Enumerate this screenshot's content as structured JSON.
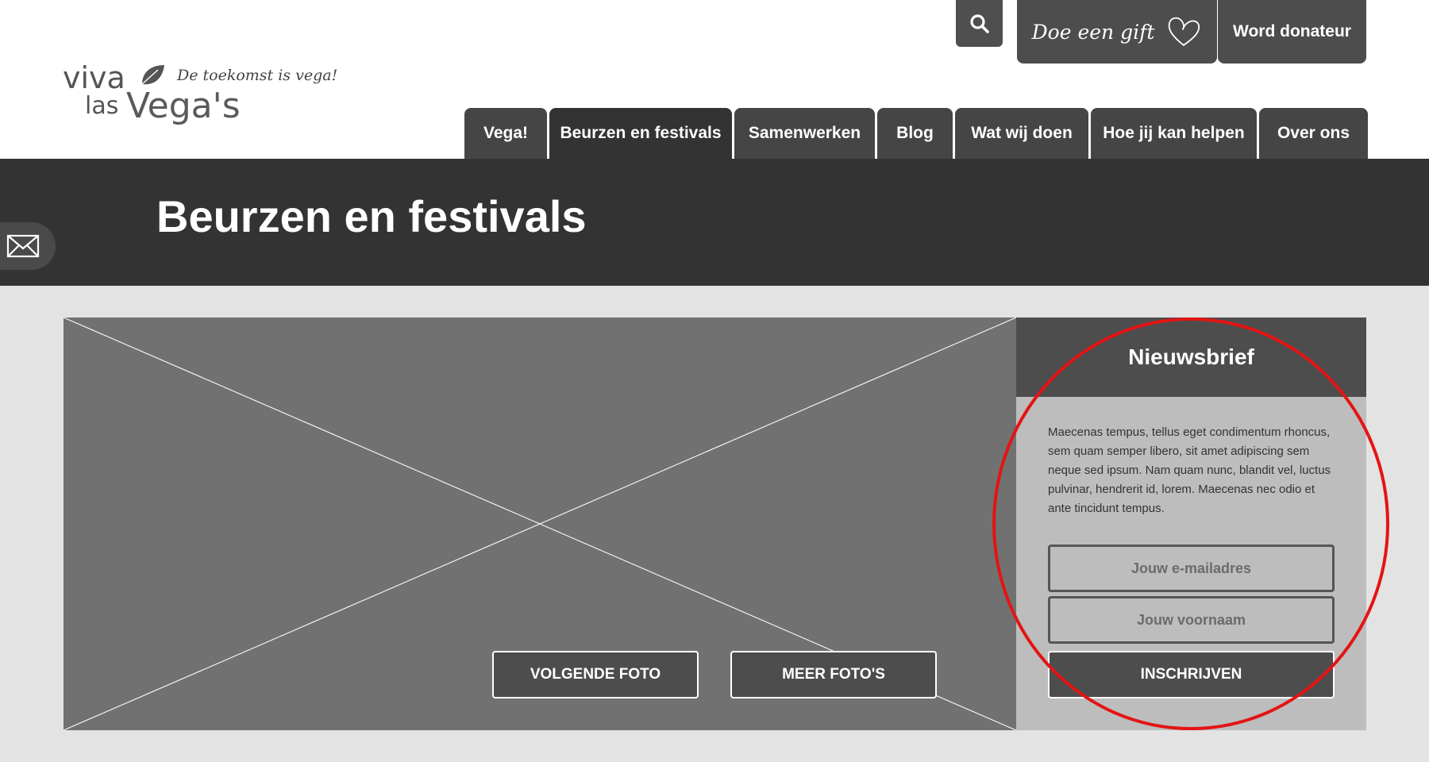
{
  "header": {
    "logo": {
      "line1": "viva",
      "line2a": "las",
      "line2b": "Vega's",
      "tagline": "De toekomst is vega!"
    },
    "search_icon": "search-icon",
    "gift_label": "Doe een gift",
    "gift_icon": "heart-icon",
    "donate_label": "Word donateur"
  },
  "nav": {
    "items": [
      {
        "label": "Vega!"
      },
      {
        "label": "Beurzen en festivals",
        "active": true
      },
      {
        "label": "Samenwerken"
      },
      {
        "label": "Blog"
      },
      {
        "label": "Wat wij doen"
      },
      {
        "label": "Hoe jij kan helpen"
      },
      {
        "label": "Over ons"
      }
    ]
  },
  "hero": {
    "title": "Beurzen en festivals",
    "mail_icon": "envelope-icon"
  },
  "photo": {
    "next_label": "VOLGENDE FOTO",
    "more_label": "MEER FOTO'S"
  },
  "newsletter": {
    "title": "Nieuwsbrief",
    "text": "Maecenas tempus, tellus eget condimentum rhoncus, sem quam semper libero, sit amet adipiscing sem neque sed ipsum. Nam quam nunc, blandit vel, luctus pulvinar, hendrerit id, lorem. Maecenas nec odio et ante tincidunt tempus.",
    "email_placeholder": "Jouw e-mailadres",
    "name_placeholder": "Jouw voornaam",
    "submit_label": "INSCHRIJVEN"
  },
  "colors": {
    "header_bg": "#ffffff",
    "hero_bg": "#333333",
    "page_bg": "#e3e3e3",
    "button_dark": "#4d4d4d",
    "placeholder_image": "#717171",
    "newsletter_bg": "#bdbdbd",
    "highlight": "#e41414"
  }
}
